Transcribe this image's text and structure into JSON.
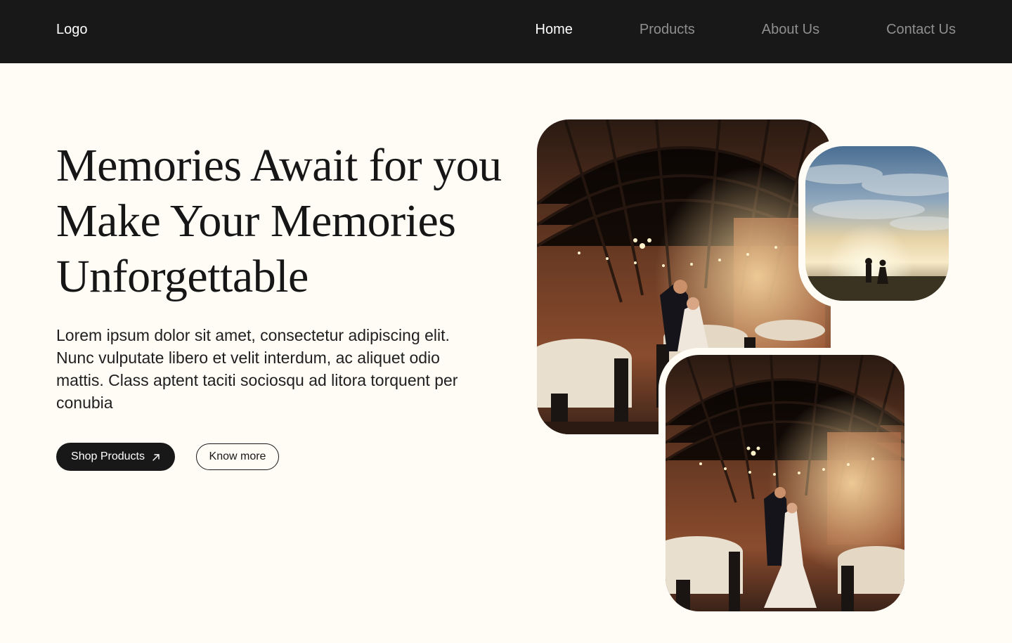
{
  "nav": {
    "logo": "Logo",
    "links": [
      {
        "label": "Home",
        "active": true
      },
      {
        "label": "Products",
        "active": false
      },
      {
        "label": "About Us",
        "active": false
      },
      {
        "label": "Contact Us",
        "active": false
      }
    ]
  },
  "hero": {
    "title_lines": [
      "Memories Await for you",
      "Make Your Memories",
      "Unforgettable"
    ],
    "description": "Lorem ipsum dolor sit amet, consectetur adipiscing elit. Nunc vulputate libero et velit interdum, ac aliquet odio mattis. Class aptent taciti sociosqu ad litora torquent per conubia",
    "primary_button": "Shop Products",
    "primary_button_icon": "arrow-up-right-icon",
    "secondary_button": "Know more"
  },
  "gallery": {
    "images": [
      {
        "name": "wedding-barn-photo",
        "subject": "couple in decorated barn venue"
      },
      {
        "name": "sunset-couple-photo",
        "subject": "couple holding hands at sunset"
      },
      {
        "name": "wedding-barn-photo-small",
        "subject": "couple in decorated barn venue"
      }
    ]
  },
  "colors": {
    "background": "#fffcf5",
    "nav_background": "#181818",
    "text": "#161616",
    "nav_inactive": "#8f8f8f",
    "nav_active": "#ffffff"
  }
}
